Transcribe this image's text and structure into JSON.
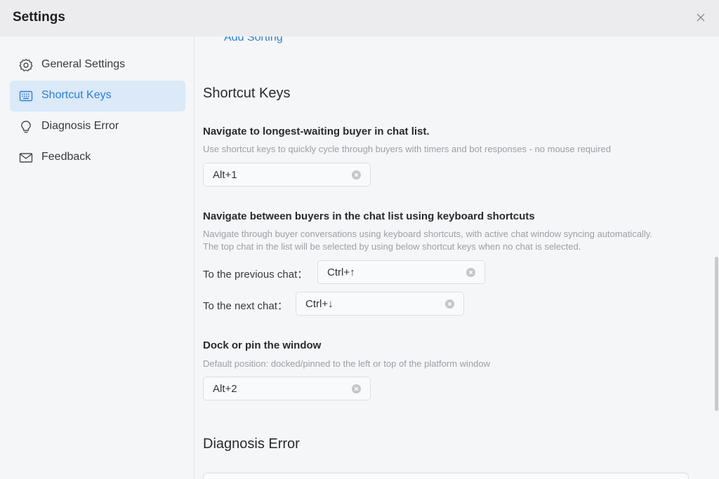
{
  "window": {
    "title": "Settings"
  },
  "sidebar": {
    "items": [
      {
        "label": "General Settings",
        "icon": "gear-icon"
      },
      {
        "label": "Shortcut Keys",
        "icon": "keyboard-icon",
        "active": true
      },
      {
        "label": "Diagnosis Error",
        "icon": "lightbulb-icon"
      },
      {
        "label": "Feedback",
        "icon": "mail-icon"
      }
    ]
  },
  "main": {
    "add_sorting_link": "Add Sorting",
    "shortcut_section": {
      "title": "Shortcut Keys",
      "longest_waiting": {
        "title": "Navigate to longest-waiting buyer in chat list.",
        "description": "Use shortcut keys to quickly cycle through buyers with timers and bot responses - no mouse required",
        "value": "Alt+1"
      },
      "navigate_between": {
        "title": "Navigate between buyers in the chat list using keyboard shortcuts",
        "description_line1": "Navigate through buyer conversations using keyboard shortcuts, with active chat window syncing automatically.",
        "description_line2": "The top chat in the list will be selected by using below shortcut keys when no chat is selected.",
        "previous_label": "To the previous chat：",
        "previous_value": "Ctrl+↑",
        "next_label": "To the next chat：",
        "next_value": "Ctrl+↓"
      },
      "dock": {
        "title": "Dock or pin the window",
        "description": "Default position: docked/pinned to the left or top of the platform window",
        "value": "Alt+2"
      }
    },
    "diagnosis_section": {
      "title": "Diagnosis Error"
    }
  },
  "colors": {
    "accent": "#2d7fd3",
    "active_bg": "#dbe9f8"
  }
}
